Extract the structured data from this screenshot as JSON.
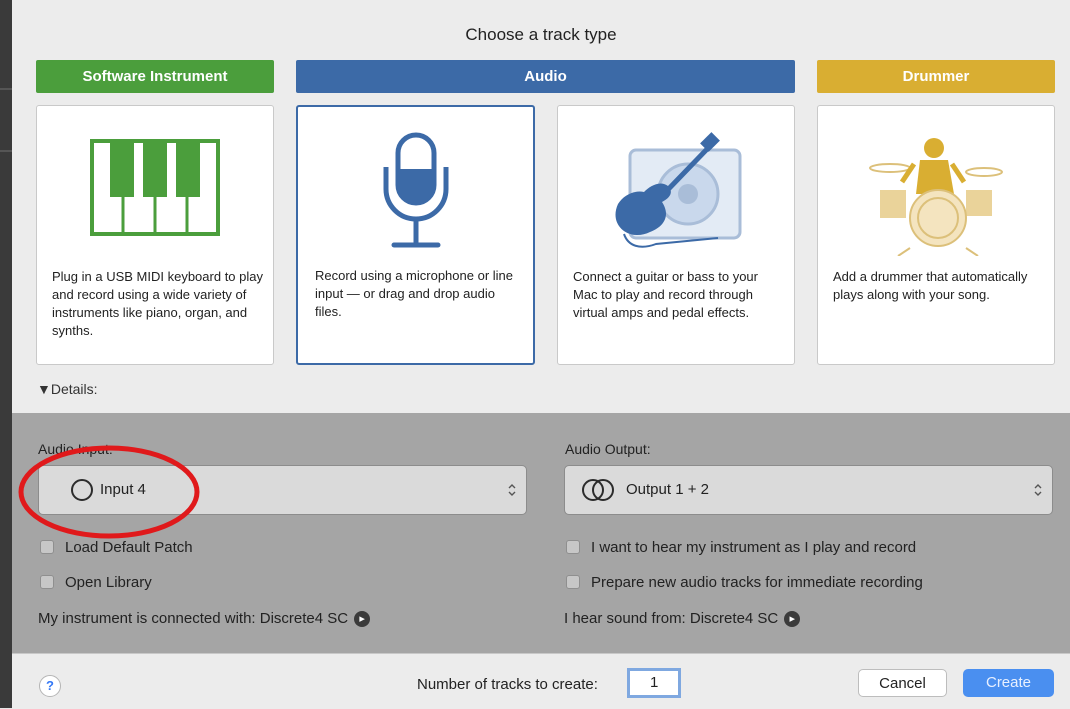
{
  "dialog": {
    "title": "Choose a track type",
    "track_types": [
      {
        "label": "Software Instrument",
        "color": "#4b9e3c",
        "description": "Plug in a USB MIDI keyboard to play and record using a wide variety of instruments like piano, organ, and synths."
      },
      {
        "label": "Audio",
        "color": "#3c6aa7",
        "description": "Record using a microphone or line input — or drag and drop audio files."
      },
      {
        "label": "",
        "color": "#3c6aa7",
        "description": "Connect a guitar or bass to your Mac to play and record through virtual amps and pedal effects."
      },
      {
        "label": "Drummer",
        "color": "#d9ae32",
        "description": "Add a drummer that automatically plays along with your song."
      }
    ],
    "details_label": "▼Details:"
  },
  "audio_input": {
    "label": "Audio Input:",
    "value": "Input 4",
    "checkboxes": [
      "Load Default Patch",
      "Open Library"
    ],
    "connection_label": "My instrument is connected with: Discrete4 SC"
  },
  "audio_output": {
    "label": "Audio Output:",
    "value": "Output 1 + 2",
    "checkboxes": [
      "I want to hear my instrument as I play and record",
      "Prepare new audio tracks for immediate recording"
    ],
    "connection_label": "I hear sound from: Discrete4 SC"
  },
  "footer": {
    "help_symbol": "?",
    "num_tracks_label": "Number of tracks to create:",
    "num_tracks_value": "1",
    "cancel_label": "Cancel",
    "create_label": "Create"
  },
  "annotation": {
    "color": "#e0191b"
  }
}
